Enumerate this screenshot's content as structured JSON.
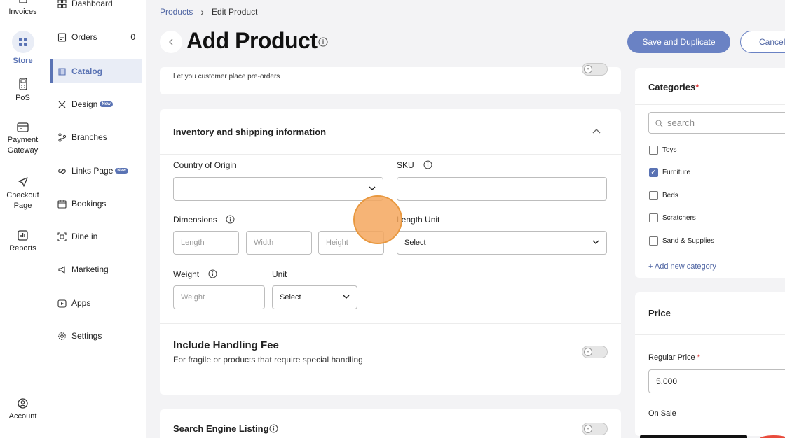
{
  "rail": {
    "items": [
      {
        "label": "Invoices"
      },
      {
        "label": "Store"
      },
      {
        "label": "PoS"
      },
      {
        "label": "Payment Gateway"
      },
      {
        "label": "Checkout Page"
      },
      {
        "label": "Reports"
      },
      {
        "label": "Account"
      }
    ]
  },
  "sidebar": {
    "items": [
      {
        "label": "Dashboard"
      },
      {
        "label": "Orders",
        "count": "0"
      },
      {
        "label": "Catalog"
      },
      {
        "label": "Design",
        "badge": "New"
      },
      {
        "label": "Branches"
      },
      {
        "label": "Links Page",
        "badge": "New"
      },
      {
        "label": "Bookings"
      },
      {
        "label": "Dine in"
      },
      {
        "label": "Marketing"
      },
      {
        "label": "Apps"
      },
      {
        "label": "Settings"
      }
    ]
  },
  "breadcrumb": {
    "parent": "Products",
    "current": "Edit Product"
  },
  "header": {
    "title": "Add Product",
    "save_duplicate": "Save and Duplicate",
    "cancel": "Cancel"
  },
  "preorder": {
    "text": "Let you customer place pre-orders"
  },
  "inventory": {
    "title": "Inventory and shipping information",
    "country_label": "Country of Origin",
    "sku_label": "SKU",
    "dimensions_label": "Dimensions",
    "length_placeholder": "Length",
    "width_placeholder": "Width",
    "height_placeholder": "Height",
    "length_unit_label": "Length Unit",
    "length_unit_value": "Select",
    "weight_label": "Weight",
    "weight_placeholder": "Weight",
    "unit_label": "Unit",
    "unit_value": "Select"
  },
  "handling": {
    "title": "Include Handling Fee",
    "subtitle": "For fragile or products that require special handling"
  },
  "seo": {
    "title": "Search Engine Listing"
  },
  "categories": {
    "title": "Categories",
    "required_mark": "*",
    "search_placeholder": "search",
    "items": [
      {
        "label": "Toys",
        "checked": false
      },
      {
        "label": "Furniture",
        "checked": true
      },
      {
        "label": "Beds",
        "checked": false
      },
      {
        "label": "Scratchers",
        "checked": false
      },
      {
        "label": "Sand & Supplies",
        "checked": false
      }
    ],
    "add_new": "+ Add new category"
  },
  "price": {
    "title": "Price",
    "regular_label": "Regular Price",
    "required_mark": "*",
    "regular_value": "5.000",
    "on_sale_label": "On Sale"
  },
  "colors": {
    "accent": "#5a73b4",
    "button": "#6a82c4",
    "cursor": "#f4a75e"
  }
}
